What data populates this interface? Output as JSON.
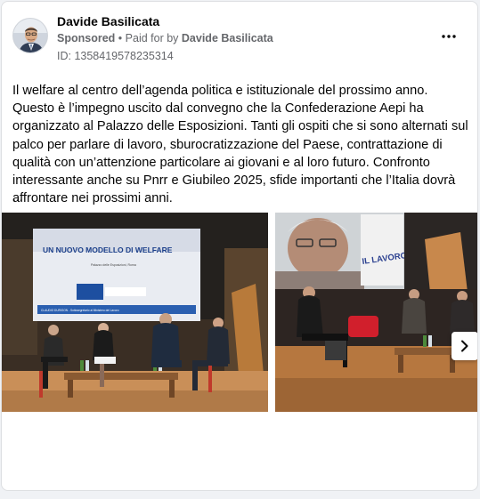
{
  "post": {
    "author_name": "Davide Basilicata",
    "sponsored_label": "Sponsored",
    "separator": "•",
    "paid_for_prefix": "Paid for by",
    "paid_for_name": "Davide Basilicata",
    "ad_id": "ID: 1358419578235314",
    "text": "Il welfare al centro dell’agenda politica e istituzionale del prossimo anno. Questo è l’impegno uscito dal convegno che la Confederazione Aepi ha organizzato al Palazzo delle Esposizioni. Tanti gli ospiti che si sono alternati sul palco per parlare di lavoro, sburocratizzazione del Paese, contrattazione di qualità con un’attenzione particolare ai giovani e al loro futuro. Confronto interessante anche su Pnrr e Giubileo 2025, sfide importanti che l’Italia dovrà affrontare nei prossimi anni.",
    "see_more": "..."
  },
  "carousel": {
    "slide1": {
      "screen_title": "UN NUOVO MODELLO DI WELFARE",
      "screen_caption": "Palazzo delle Esposizioni, Roma",
      "screen_speaker": "CLAUDIO DURIGON - Sottosegretario al Ministero del Lavoro"
    },
    "slide2": {
      "banner_text": "IL LAVORO"
    }
  },
  "icons": {
    "more": "more-horizontal-icon",
    "next": "chevron-right-icon"
  },
  "colors": {
    "meta_text": "#65676b",
    "card_bg": "#ffffff",
    "page_bg": "#f0f2f5"
  }
}
